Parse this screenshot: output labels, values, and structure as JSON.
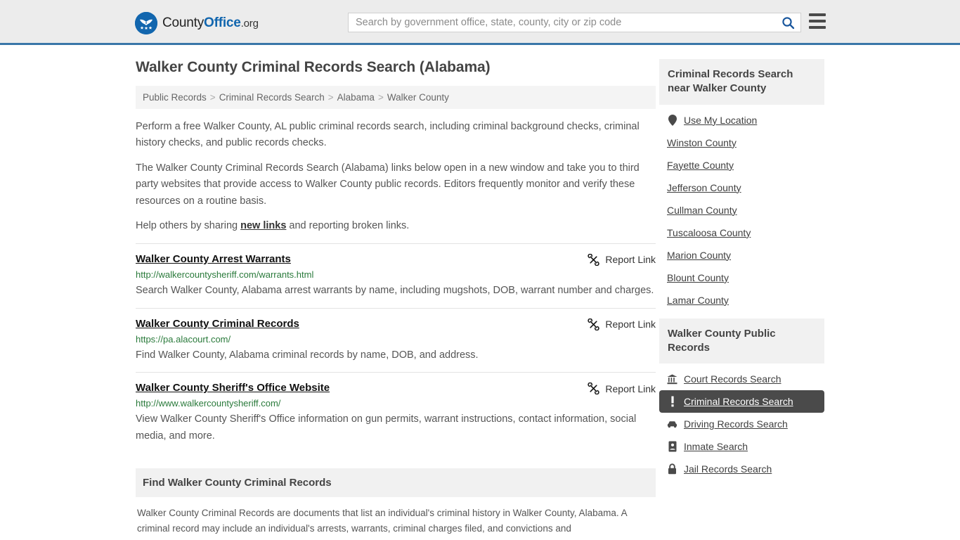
{
  "header": {
    "logo_text_1": "County",
    "logo_text_2": "Office",
    "logo_text_3": ".org",
    "logo_icon": "eagle-shield-icon",
    "search_placeholder": "Search by government office, state, county, city or zip code",
    "search_value": "",
    "search_icon": "search-icon",
    "menu_icon": "hamburger-menu-icon",
    "accent_color": "#1266ae",
    "border_color": "#3a76a8",
    "bg_color": "#ececec"
  },
  "main": {
    "page_title": "Walker County Criminal Records Search (Alabama)",
    "breadcrumb": [
      "Public Records",
      "Criminal Records Search",
      "Alabama",
      "Walker County"
    ],
    "breadcrumb_separator": ">",
    "intro_paragraphs": [
      "Perform a free Walker County, AL public criminal records search, including criminal background checks, criminal history checks, and public records checks.",
      "The Walker County Criminal Records Search (Alabama) links below open in a new window and take you to third party websites that provide access to Walker County public records. Editors frequently monitor and verify these resources on a routine basis."
    ],
    "help_prefix": "Help others by sharing ",
    "help_link": "new links",
    "help_suffix": " and reporting broken links.",
    "report_link_label": "Report Link",
    "report_link_icon": "broken-link-icon",
    "results": [
      {
        "title": "Walker County Arrest Warrants",
        "url": "http://walkercountysheriff.com/warrants.html",
        "description": "Search Walker County, Alabama arrest warrants by name, including mugshots, DOB, warrant number and charges."
      },
      {
        "title": "Walker County Criminal Records",
        "url": "https://pa.alacourt.com/",
        "description": "Find Walker County, Alabama criminal records by name, DOB, and address."
      },
      {
        "title": "Walker County Sheriff's Office Website",
        "url": "http://www.walkercountysheriff.com/",
        "description": "View Walker County Sheriff's Office information on gun permits, warrant instructions, contact information, social media, and more."
      }
    ],
    "info_section": {
      "heading": "Find Walker County Criminal Records",
      "body": "Walker County Criminal Records are documents that list an individual's criminal history in Walker County, Alabama. A criminal record may include an individual's arrests, warrants, criminal charges filed, and convictions and"
    },
    "url_color": "#2a7a3b"
  },
  "sidebar": {
    "nearby": {
      "heading": "Criminal Records Search near Walker County",
      "items": [
        {
          "label": "Use My Location",
          "icon": "map-pin-icon"
        },
        {
          "label": "Winston County",
          "icon": ""
        },
        {
          "label": "Fayette County",
          "icon": ""
        },
        {
          "label": "Jefferson County",
          "icon": ""
        },
        {
          "label": "Cullman County",
          "icon": ""
        },
        {
          "label": "Tuscaloosa County",
          "icon": ""
        },
        {
          "label": "Marion County",
          "icon": ""
        },
        {
          "label": "Blount County",
          "icon": ""
        },
        {
          "label": "Lamar County",
          "icon": ""
        }
      ]
    },
    "public_records": {
      "heading": "Walker County Public Records",
      "items": [
        {
          "label": "Court Records Search",
          "icon": "courthouse-icon",
          "active": false
        },
        {
          "label": "Criminal Records Search",
          "icon": "exclamation-icon",
          "active": true
        },
        {
          "label": "Driving Records Search",
          "icon": "car-icon",
          "active": false
        },
        {
          "label": "Inmate Search",
          "icon": "id-badge-icon",
          "active": false
        },
        {
          "label": "Jail Records Search",
          "icon": "padlock-icon",
          "active": false
        }
      ]
    },
    "active_bg_color": "#4a4a4a"
  }
}
